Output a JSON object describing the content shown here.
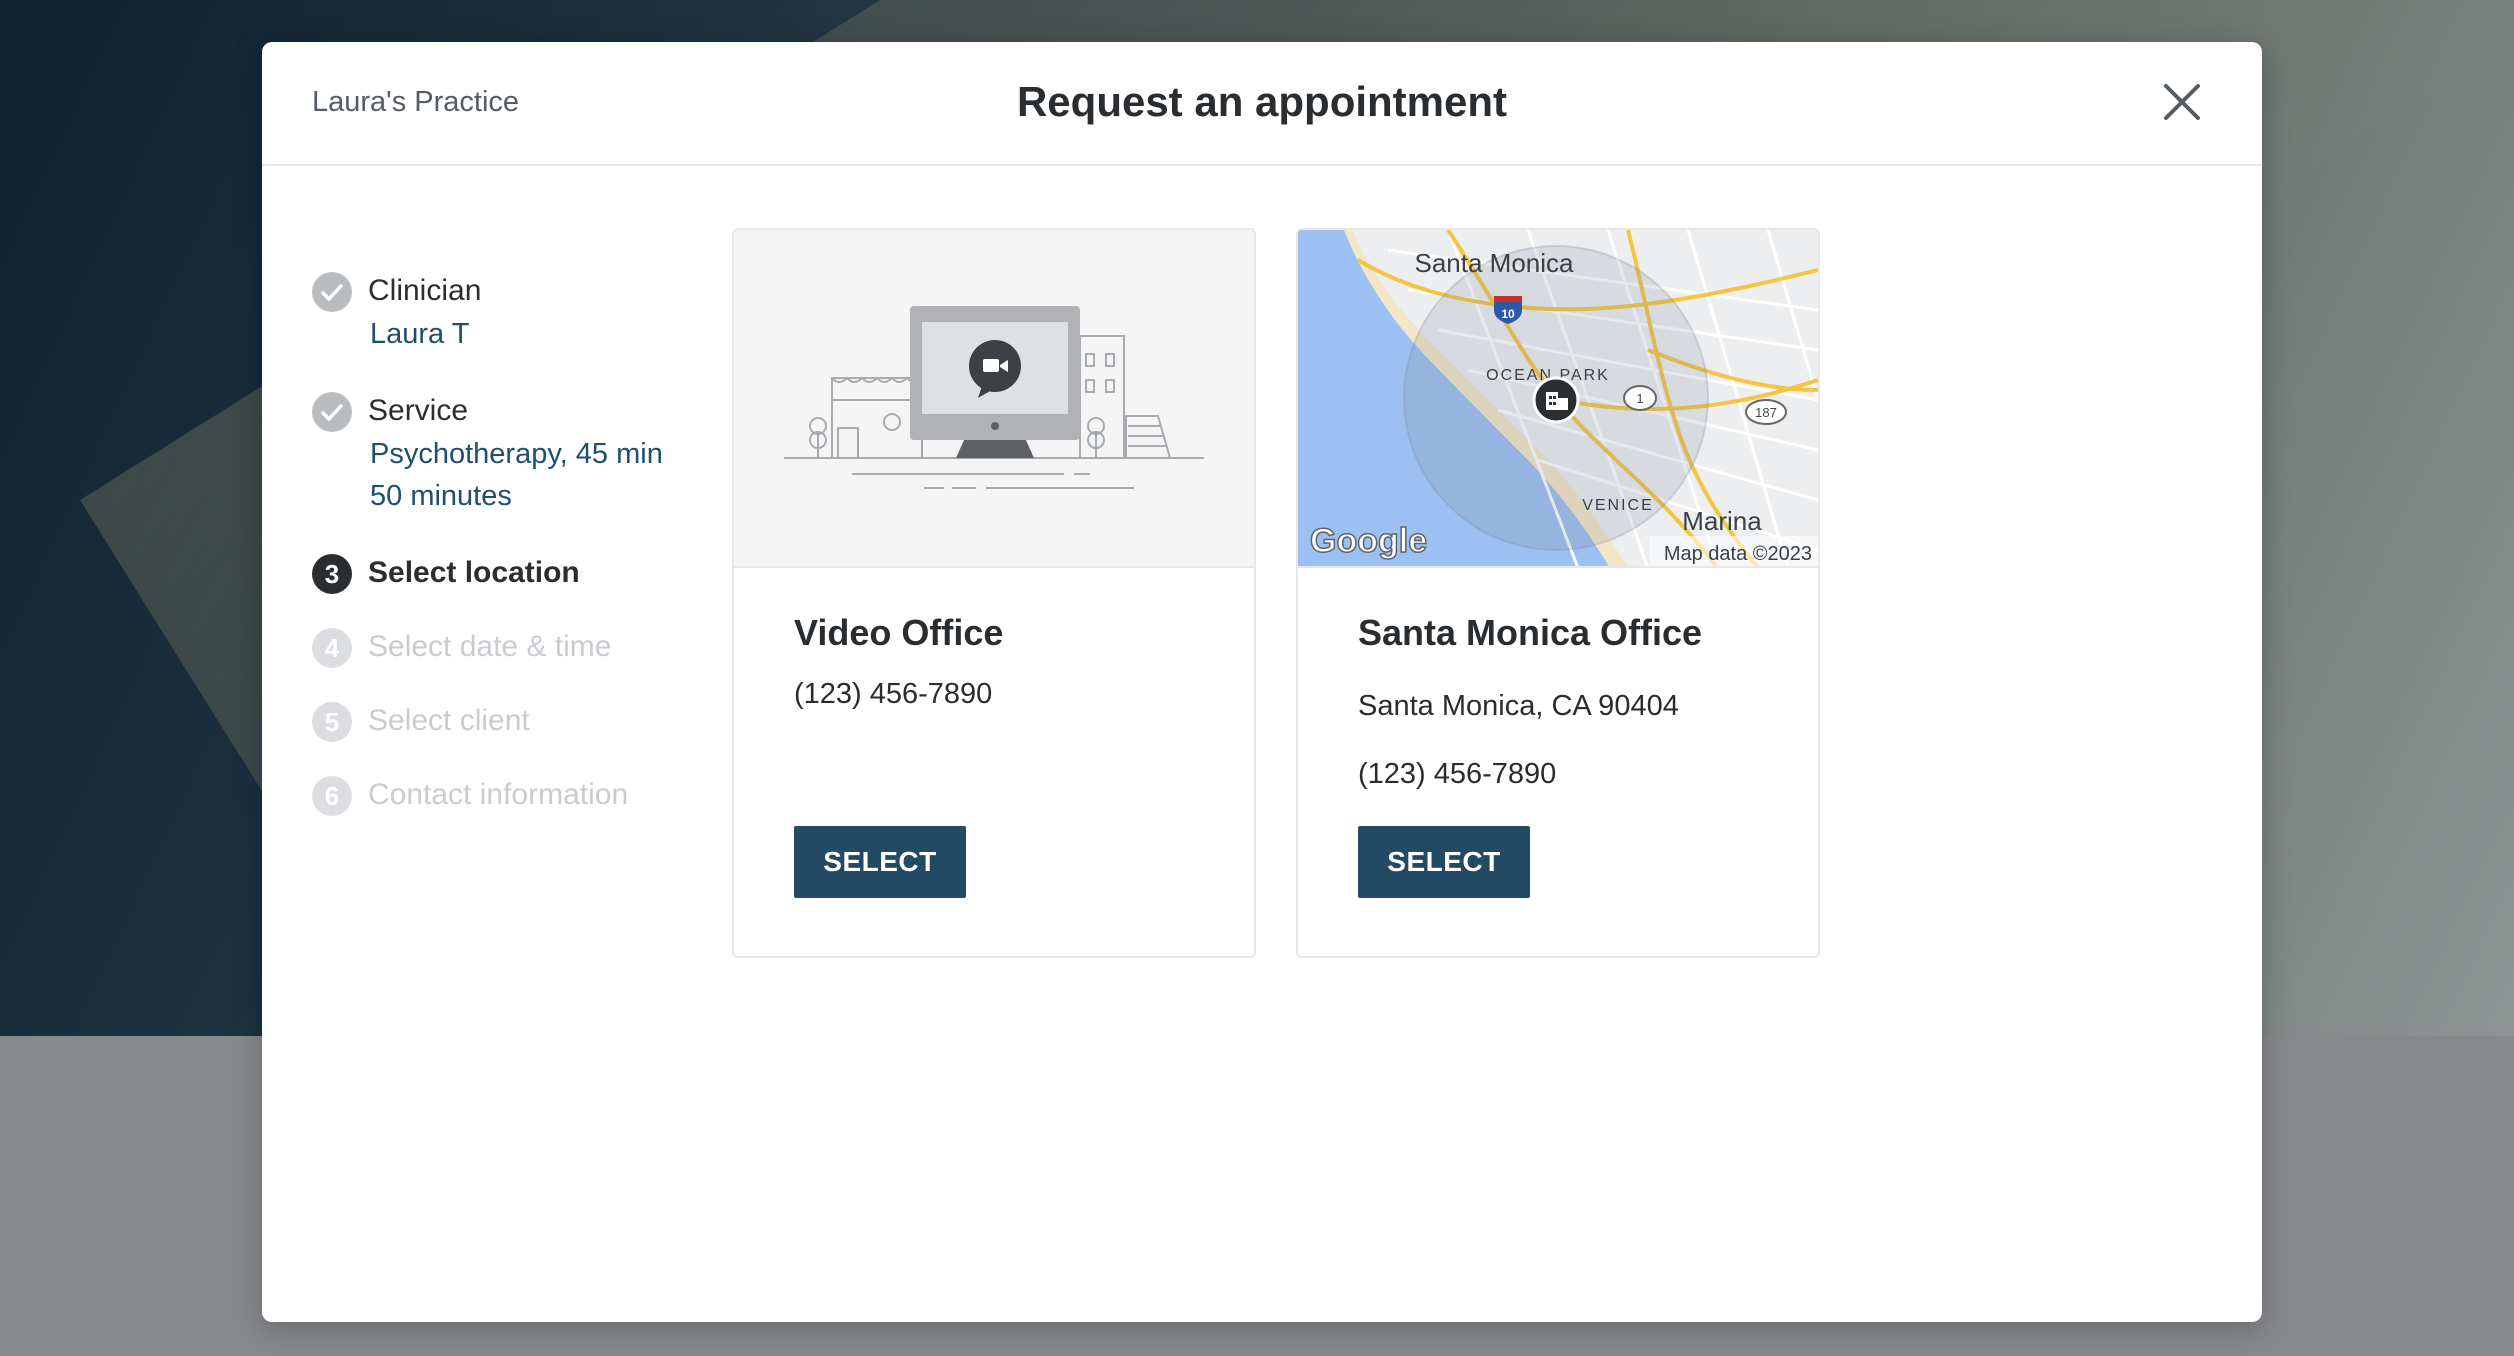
{
  "header": {
    "practice_name": "Laura's Practice",
    "title": "Request an appointment",
    "close_icon": "close-icon"
  },
  "steps": [
    {
      "number": "1",
      "label": "Clinician",
      "state": "done",
      "details": [
        "Laura T"
      ]
    },
    {
      "number": "2",
      "label": "Service",
      "state": "done",
      "details": [
        "Psychotherapy, 45 min",
        "50 minutes"
      ]
    },
    {
      "number": "3",
      "label": "Select location",
      "state": "active",
      "details": []
    },
    {
      "number": "4",
      "label": "Select date & time",
      "state": "pending",
      "details": []
    },
    {
      "number": "5",
      "label": "Select client",
      "state": "pending",
      "details": []
    },
    {
      "number": "6",
      "label": "Contact information",
      "state": "pending",
      "details": []
    }
  ],
  "locations": [
    {
      "name": "Video Office",
      "phone": "(123) 456-7890",
      "address": "",
      "button": "SELECT",
      "media": "video-office-illustration"
    },
    {
      "name": "Santa Monica Office",
      "address": "Santa Monica, CA 90404",
      "phone": "(123) 456-7890",
      "button": "SELECT",
      "media": "map-thumbnail",
      "map": {
        "labels": [
          "Santa Monica",
          "OCEAN PARK",
          "VENICE",
          "Marina"
        ],
        "road_shields": [
          "10",
          "1",
          "187"
        ],
        "provider": "Google",
        "attribution": "Map data ©2023"
      }
    }
  ],
  "colors": {
    "accent": "#234a63",
    "link": "#1f4f6e",
    "step_done": "#b9bcbf",
    "step_active": "#2b2e31",
    "step_pending": "#dcdde0"
  }
}
